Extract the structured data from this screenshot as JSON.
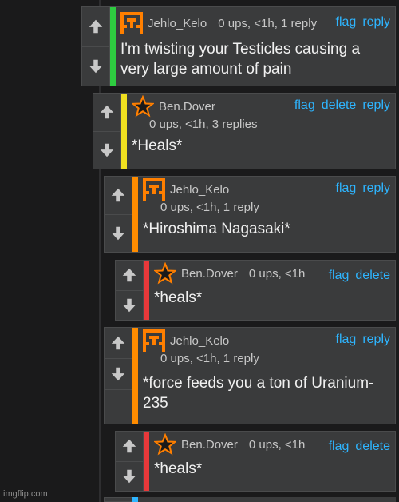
{
  "colors": {
    "link": "#2eb5ff",
    "depth1": "#2ecc40",
    "depth2": "#f0e020",
    "depth3": "#ff8c00",
    "depth4": "#e8383a"
  },
  "comments": [
    {
      "username": "Jehlo_Kelo",
      "stats": "0 ups, <1h, 1 reply",
      "actions": [
        "flag",
        "reply"
      ],
      "text": "I'm twisting your Testicles causing a very large amount of pain",
      "avatar": "pixel-avatar-orange"
    },
    {
      "username": "Ben.Dover",
      "stats": "0 ups, <1h, 3 replies",
      "actions": [
        "flag",
        "delete",
        "reply"
      ],
      "text": "*Heals*",
      "avatar": "star-avatar"
    },
    {
      "username": "Jehlo_Kelo",
      "stats": "0 ups, <1h, 1 reply",
      "actions": [
        "flag",
        "reply"
      ],
      "text": "*Hiroshima Nagasaki*",
      "avatar": "pixel-avatar-orange"
    },
    {
      "username": "Ben.Dover",
      "stats": "0 ups, <1h",
      "actions": [
        "flag",
        "delete"
      ],
      "text": "*heals*",
      "avatar": "star-avatar"
    },
    {
      "username": "Jehlo_Kelo",
      "stats": "0 ups, <1h, 1 reply",
      "actions": [
        "flag",
        "reply"
      ],
      "text": "*force feeds you a ton of Uranium-235",
      "avatar": "pixel-avatar-orange"
    },
    {
      "username": "Ben.Dover",
      "stats": "0 ups, <1h",
      "actions": [
        "flag",
        "delete"
      ],
      "text": "*heals*",
      "avatar": "star-avatar"
    }
  ],
  "watermark": "imgflip.com"
}
